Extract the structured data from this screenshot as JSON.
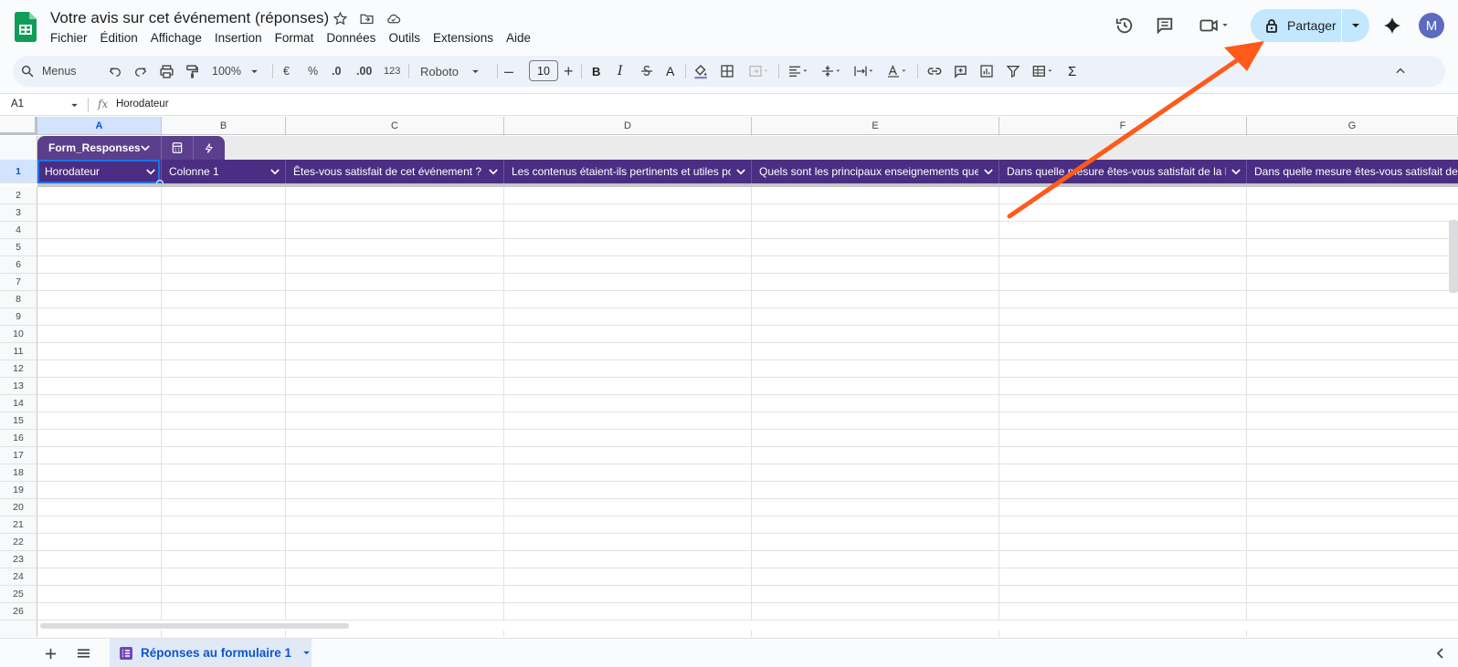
{
  "doc": {
    "title": "Votre avis sur cet événement (réponses)"
  },
  "menu": [
    "Fichier",
    "Édition",
    "Affichage",
    "Insertion",
    "Format",
    "Données",
    "Outils",
    "Extensions",
    "Aide"
  ],
  "header": {
    "share_label": "Partager",
    "avatar_initial": "M"
  },
  "toolbar": {
    "search_label": "Menus",
    "zoom": "100%",
    "currency": "€",
    "percent": "%",
    "dec_decrease": ".0",
    "dec_increase": ".00",
    "number_format": "123",
    "font": "Roboto",
    "font_size": "10",
    "bold": "B",
    "italic": "I",
    "text_color": "A",
    "sum": "Σ"
  },
  "formula_bar": {
    "cell_ref": "A1",
    "fx": "fx",
    "content": "Horodateur"
  },
  "columns": [
    "A",
    "B",
    "C",
    "D",
    "E",
    "F",
    "G"
  ],
  "table": {
    "name": "Form_Responses",
    "headers": [
      "Horodateur",
      "Colonne 1",
      "Êtes-vous satisfait de cet événement ?",
      "Les contenus étaient-ils pertinents et utiles po",
      "Quels sont les principaux enseignements que",
      "Dans quelle mesure êtes-vous satisfait de la l",
      "Dans quelle mesure êtes-vous satisfait de"
    ]
  },
  "rows": [
    "1",
    "2",
    "3",
    "4",
    "5",
    "6",
    "7",
    "8",
    "9",
    "10",
    "11",
    "12",
    "13",
    "14",
    "15",
    "16",
    "17",
    "18",
    "19",
    "20",
    "21",
    "22",
    "23",
    "24",
    "25",
    "26"
  ],
  "sheet_tab": {
    "label": "Réponses au formulaire 1"
  },
  "colors": {
    "table_header": "#4b2e83",
    "share_bg": "#c2e7ff",
    "annotation_arrow": "#ff5a1a",
    "sheets_green": "#0f9d58"
  }
}
